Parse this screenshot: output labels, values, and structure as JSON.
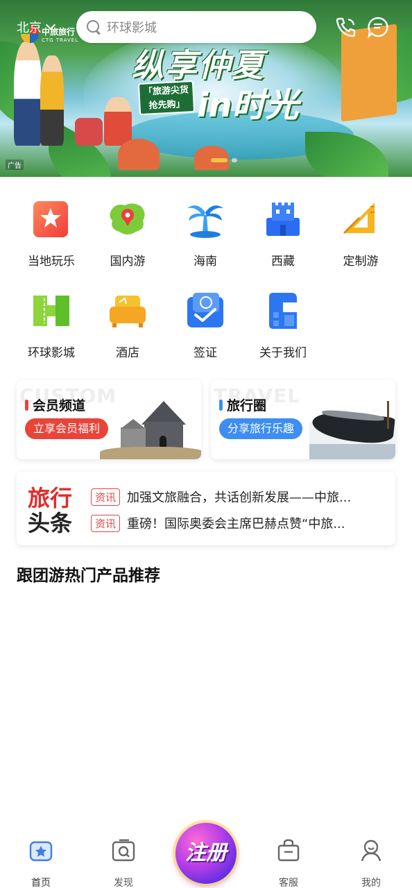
{
  "top_bar": {
    "city": "北京",
    "search_placeholder": "环球影城"
  },
  "banner": {
    "logo_cn": "中旅旅行",
    "logo_en": "CTG TRAVEL",
    "slogan_line1": "纵享仲夏",
    "slogan_line2": "in时光",
    "tag_line1": "「旅游尖货",
    "tag_line2": "抢先购」",
    "ad_label": "广告"
  },
  "categories": [
    {
      "label": "当地玩乐",
      "icon": "star-flag-icon"
    },
    {
      "label": "国内游",
      "icon": "map-pin-icon"
    },
    {
      "label": "海南",
      "icon": "palm-tree-icon"
    },
    {
      "label": "西藏",
      "icon": "palace-icon"
    },
    {
      "label": "定制游",
      "icon": "ruler-triangle-icon"
    },
    {
      "label": "环球影城",
      "icon": "ticket-icon"
    },
    {
      "label": "酒店",
      "icon": "sofa-icon"
    },
    {
      "label": "签证",
      "icon": "passport-icon"
    },
    {
      "label": "关于我们",
      "icon": "building-icon"
    }
  ],
  "promos": [
    {
      "bg_word": "CUSTOM",
      "title": "会员频道",
      "button": "立享会员福利",
      "accent": "#e8443a"
    },
    {
      "bg_word": "TRAVEL",
      "title": "旅行圈",
      "button": "分享旅行乐趣",
      "accent": "#3d8ef0"
    }
  ],
  "news": {
    "brand_line1": "旅行",
    "brand_line2": "头条",
    "items": [
      {
        "badge": "资讯",
        "headline": "加强文旅融合，共话创新发展——中旅..."
      },
      {
        "badge": "资讯",
        "headline": "重磅！国际奥委会主席巴赫点赞“中旅..."
      }
    ]
  },
  "section_title": "跟团游热门产品推荐",
  "bottom_nav": {
    "tabs": [
      {
        "label": "首页",
        "icon": "home-icon",
        "active": true
      },
      {
        "label": "发现",
        "icon": "discover-icon",
        "active": false
      },
      {
        "label": "客服",
        "icon": "service-bag-icon",
        "active": false
      },
      {
        "label": "我的",
        "icon": "profile-icon",
        "active": false
      }
    ],
    "register_label": "注册"
  },
  "colors": {
    "brand_blue": "#3d7fe6",
    "red": "#e8443a",
    "banner_green": "#2f7a3a"
  }
}
